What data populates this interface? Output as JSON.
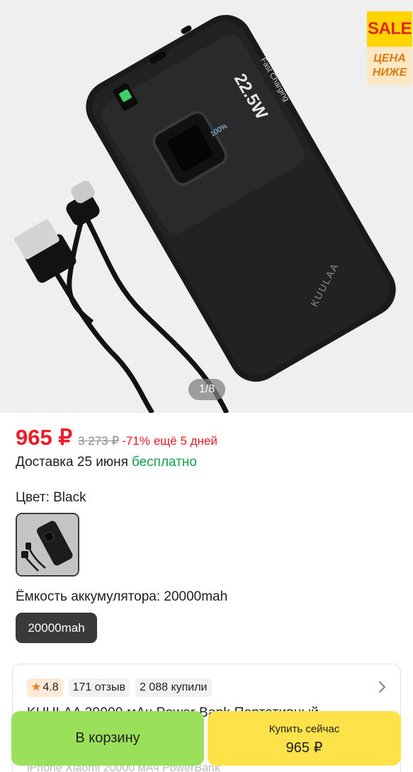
{
  "gallery": {
    "counter": "1/8",
    "sale_badge": {
      "sale": "SALE",
      "line1": "ЦЕНА",
      "line2": "НИЖЕ"
    },
    "product_brand_print": "KUULAA",
    "product_panel_print": "22.5W",
    "product_panel_sub": "Fast Charging",
    "product_display": "100%"
  },
  "price": {
    "current": "965 ₽",
    "old": "3 273 ₽",
    "discount": "-71%",
    "days_left": "ещё 5 дней",
    "accent": "#ee1c25"
  },
  "delivery": {
    "text": "Доставка 25 июня",
    "free": "бесплатно",
    "free_color": "#14a04a"
  },
  "color": {
    "label": "Цвет: Black",
    "selected_swatch": "black-power-bank-thumbnail"
  },
  "capacity": {
    "label": "Ёмкость аккумулятора: 20000mah",
    "selected": "20000mah"
  },
  "reviews": {
    "rating": "4.8",
    "reviews_count": "171 отзыв",
    "bought": "2 088 купили",
    "chevron_icon": "chevron-right-icon",
    "title_visible": "KUULAA 20000 мАч Power Bank Портативный",
    "subtitle_visible": "iPhone Xiaomi 20000 мАч PowerBank"
  },
  "actions": {
    "cart_label": "В корзину",
    "buy_label": "Купить сейчас",
    "buy_price": "965 ₽",
    "cart_color": "#9be05a",
    "buy_color": "#fde24a"
  }
}
